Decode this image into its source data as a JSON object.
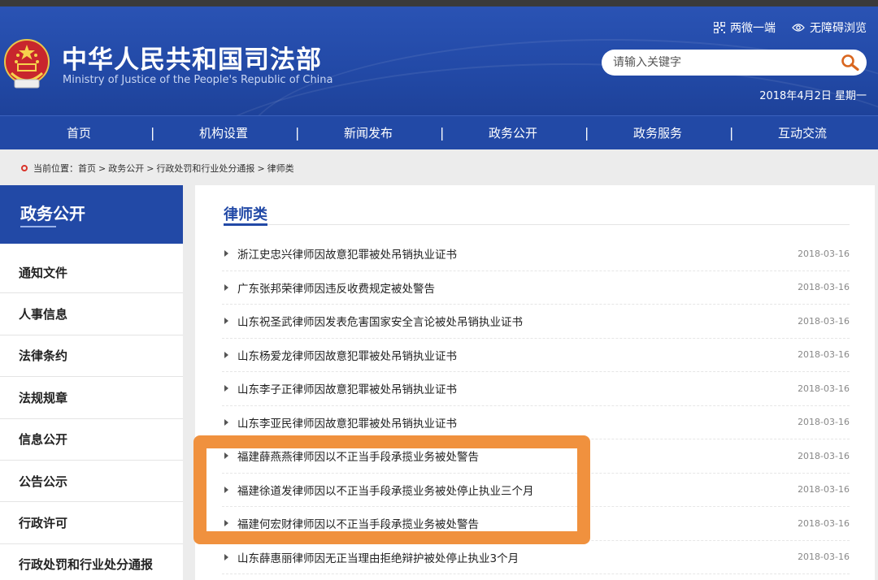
{
  "header": {
    "title_cn": "中华人民共和国司法部",
    "title_en": "Ministry of Justice of the People's Republic of China",
    "links": [
      {
        "label": "两微一端",
        "icon": "qrcode-icon"
      },
      {
        "label": "无障碍浏览",
        "icon": "eye-icon"
      }
    ],
    "search_placeholder": "请输入关键字",
    "date": "2018年4月2日 星期一"
  },
  "nav": [
    "首页",
    "机构设置",
    "新闻发布",
    "政务公开",
    "政务服务",
    "互动交流"
  ],
  "breadcrumb": {
    "prefix": "当前位置：",
    "items": [
      "首页",
      "政务公开",
      "行政处罚和行业处分通报",
      "律师类"
    ]
  },
  "sidebar": {
    "title": "政务公开",
    "items": [
      "通知文件",
      "人事信息",
      "法律条约",
      "法规规章",
      "信息公开",
      "公告公示",
      "行政许可",
      "行政处罚和行业处分通报"
    ]
  },
  "main": {
    "title": "律师类",
    "rows": [
      {
        "title": "浙江史忠兴律师因故意犯罪被处吊销执业证书",
        "date": "2018-03-16"
      },
      {
        "title": "广东张邦荣律师因违反收费规定被处警告",
        "date": "2018-03-16"
      },
      {
        "title": "山东祝圣武律师因发表危害国家安全言论被处吊销执业证书",
        "date": "2018-03-16"
      },
      {
        "title": "山东杨爱龙律师因故意犯罪被处吊销执业证书",
        "date": "2018-03-16"
      },
      {
        "title": "山东李子正律师因故意犯罪被处吊销执业证书",
        "date": "2018-03-16"
      },
      {
        "title": "山东李亚民律师因故意犯罪被处吊销执业证书",
        "date": "2018-03-16"
      },
      {
        "title": "福建薛燕燕律师因以不正当手段承揽业务被处警告",
        "date": "2018-03-16"
      },
      {
        "title": "福建徐道发律师因以不正当手段承揽业务被处停止执业三个月",
        "date": "2018-03-16"
      },
      {
        "title": "福建何宏财律师因以不正当手段承揽业务被处警告",
        "date": "2018-03-16"
      },
      {
        "title": "山东薛惠丽律师因无正当理由拒绝辩护被处停止执业3个月",
        "date": "2018-03-16"
      }
    ]
  },
  "colors": {
    "brand_blue": "#2249a6",
    "highlight_orange": "#f0913e"
  }
}
